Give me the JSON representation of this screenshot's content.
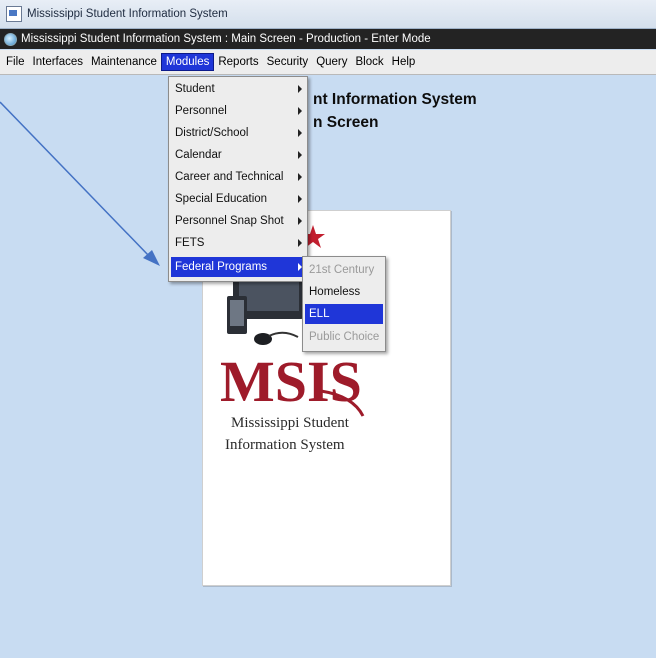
{
  "outer_window": {
    "title": "Mississippi Student Information System"
  },
  "inner_window": {
    "title": "Mississippi Student Information System : Main Screen - Production - Enter Mode"
  },
  "menubar": {
    "items": [
      "File",
      "Interfaces",
      "Maintenance",
      "Modules",
      "Reports",
      "Security",
      "Query",
      "Block",
      "Help"
    ],
    "active": "Modules"
  },
  "main": {
    "app_title": "nt Information System",
    "screen_title": "n Screen"
  },
  "logo": {
    "wordmark": "MSIS",
    "caption_line1": "Mississippi Student",
    "caption_line2": "Information System"
  },
  "modules_menu": {
    "items": [
      {
        "label": "Student",
        "has_submenu": true
      },
      {
        "label": "Personnel",
        "has_submenu": true
      },
      {
        "label": "District/School",
        "has_submenu": true
      },
      {
        "label": "Calendar",
        "has_submenu": true
      },
      {
        "label": "Career and Technical",
        "has_submenu": true
      },
      {
        "label": "Special Education",
        "has_submenu": true
      },
      {
        "label": "Personnel Snap Shot",
        "has_submenu": true
      },
      {
        "label": "FETS",
        "has_submenu": true
      },
      {
        "label": "Federal Programs",
        "has_submenu": true,
        "highlighted": true
      }
    ]
  },
  "federal_programs_submenu": {
    "items": [
      {
        "label": "21st Century",
        "enabled": false
      },
      {
        "label": "Homeless",
        "enabled": true
      },
      {
        "label": "ELL",
        "enabled": true,
        "highlighted": true
      },
      {
        "label": "Public Choice",
        "enabled": false
      }
    ]
  },
  "colors": {
    "workspace": "#c8dcf2",
    "menu_highlight": "#1f36d8",
    "logo_red": "#9e1b2a",
    "annotation_arrow": "#4472c4"
  },
  "icons": {
    "outer_app": "window-app-icon",
    "inner_form": "form-globe-icon",
    "submenu": "chevron-right-icon"
  }
}
